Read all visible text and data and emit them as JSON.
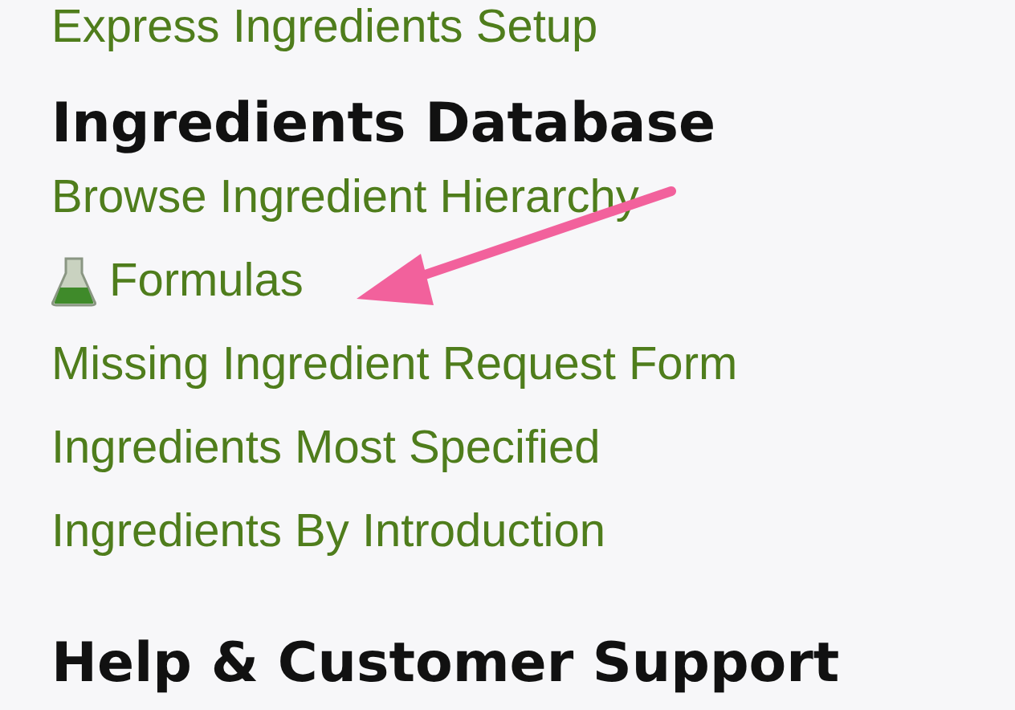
{
  "top_link": "Express Ingredients Setup",
  "section": {
    "heading": "Ingredients Database",
    "links": [
      {
        "text": "Browse Ingredient Hierarchy",
        "has_icon": false
      },
      {
        "text": "Formulas",
        "has_icon": true
      },
      {
        "text": "Missing Ingredient Request Form",
        "has_icon": false
      },
      {
        "text": "Ingredients Most Specified",
        "has_icon": false
      },
      {
        "text": "Ingredients By Introduction",
        "has_icon": false
      }
    ]
  },
  "next_heading": "Help & Customer Support"
}
